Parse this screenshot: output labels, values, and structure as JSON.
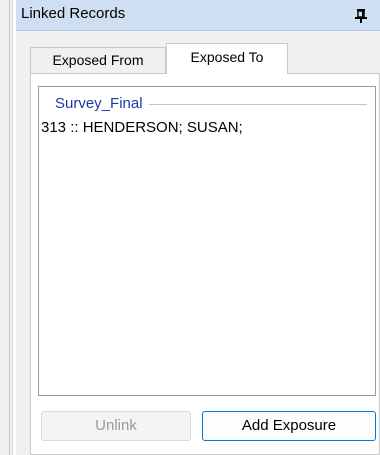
{
  "panel": {
    "title": "Linked Records",
    "pin_icon": "pushpin-icon"
  },
  "tabs": [
    {
      "label": "Exposed From",
      "active": false
    },
    {
      "label": "Exposed To",
      "active": true
    }
  ],
  "list": {
    "group_title": "Survey_Final",
    "items": [
      {
        "label": "313 :: HENDERSON; SUSAN;"
      }
    ]
  },
  "buttons": {
    "unlink_label": "Unlink",
    "unlink_enabled": false,
    "add_label": "Add Exposure",
    "add_enabled": true
  },
  "colors": {
    "titlebar_bg": "#cfdff3",
    "group_title": "#1e3aa8",
    "focus_border": "#0078d7",
    "disabled_text": "#9a9a9a"
  }
}
